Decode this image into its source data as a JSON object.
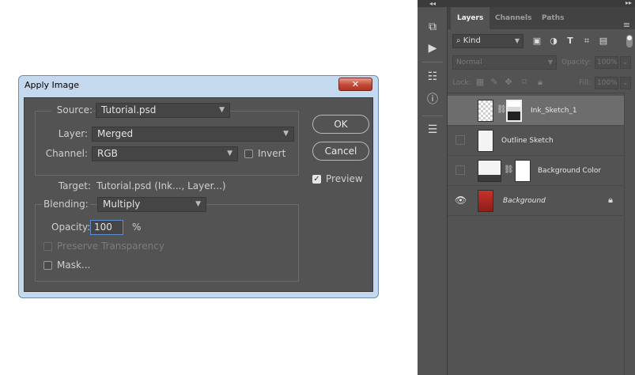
{
  "dialog": {
    "title": "Apply Image",
    "close_glyph": "✕",
    "source_label": "Source:",
    "source_value": "Tutorial.psd",
    "layer_label": "Layer:",
    "layer_value": "Merged",
    "channel_label": "Channel:",
    "channel_value": "RGB",
    "invert_label": "Invert",
    "target_label": "Target:",
    "target_value": "Tutorial.psd (Ink..., Layer...)",
    "blending_label": "Blending:",
    "blending_value": "Multiply",
    "opacity_label": "Opacity:",
    "opacity_value": "100",
    "opacity_unit": "%",
    "preserve_transparency_label": "Preserve Transparency",
    "mask_label": "Mask...",
    "ok_label": "OK",
    "cancel_label": "Cancel",
    "preview_label": "Preview",
    "preview_checked": true
  },
  "toolstrip": {
    "collapse_glyph": "◂◂",
    "icons": [
      "history-icon",
      "play-actions-icon",
      "properties-icon",
      "info-icon",
      "libraries-icon"
    ]
  },
  "layers_panel": {
    "tabs": [
      "Layers",
      "Channels",
      "Paths"
    ],
    "active_tab": "Layers",
    "kind_label": "Kind",
    "blend_mode": "Normal",
    "opacity_label": "Opacity:",
    "opacity_value": "100%",
    "lock_label": "Lock:",
    "fill_label": "Fill:",
    "fill_value": "100%",
    "layers": [
      {
        "name": "Ink_Sketch_1",
        "visible": false,
        "selected": true,
        "has_mask": true
      },
      {
        "name": "Outline Sketch",
        "visible": false,
        "selected": false,
        "has_mask": false
      },
      {
        "name": "Background Color",
        "visible": false,
        "selected": false,
        "has_mask": true
      },
      {
        "name": "Background",
        "visible": true,
        "selected": false,
        "locked": true
      }
    ]
  },
  "colors": {
    "dialog_frame": "#c4d8ee",
    "ps_panel": "#535353",
    "close_button": "#c24a36"
  }
}
